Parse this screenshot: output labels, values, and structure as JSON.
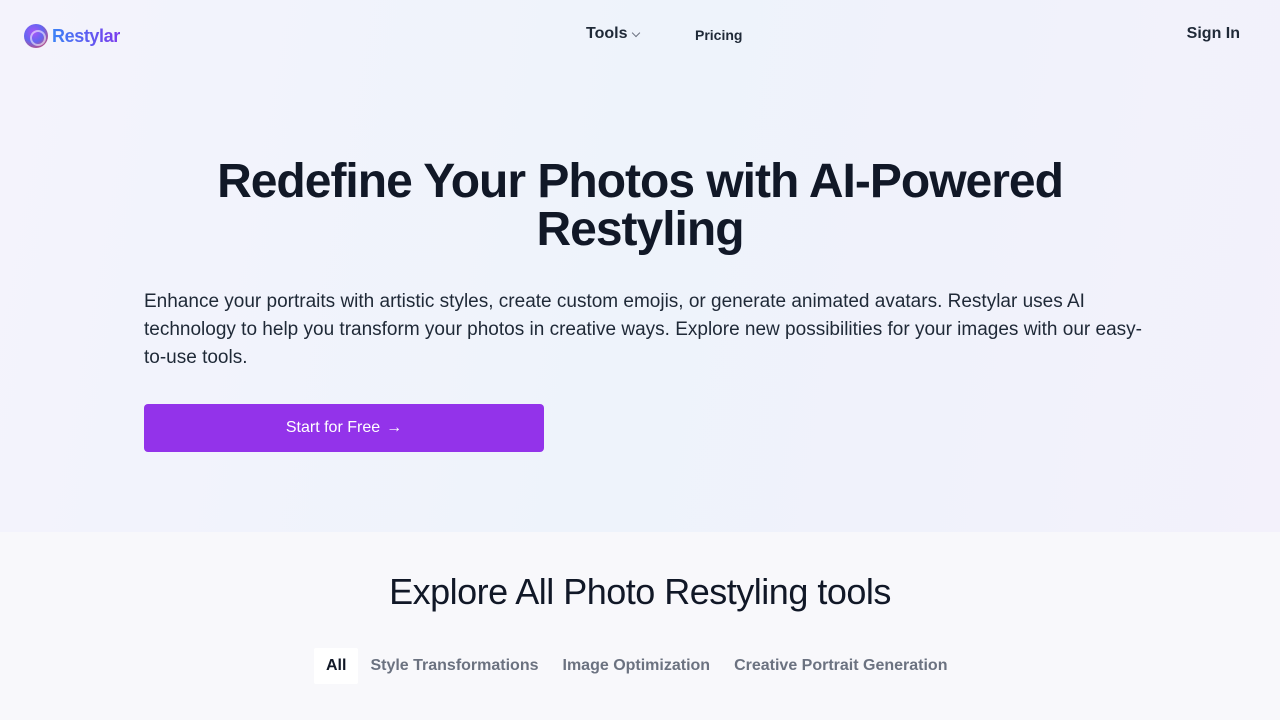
{
  "header": {
    "brand": "Restylar",
    "nav": {
      "tools_label": "Tools",
      "pricing_label": "Pricing"
    },
    "sign_in_label": "Sign In"
  },
  "hero": {
    "title": "Redefine Your Photos with AI-Powered Restyling",
    "description": "Enhance your portraits with artistic styles, create custom emojis, or generate animated avatars. Restylar uses AI technology to help you transform your photos in creative ways. Explore new possibilities for your images with our easy-to-use tools.",
    "cta_label": "Start for Free",
    "cta_arrow": "→"
  },
  "tools_section": {
    "title": "Explore All Photo Restyling tools",
    "filters": [
      {
        "label": "All",
        "active": true
      },
      {
        "label": "Style Transformations",
        "active": false
      },
      {
        "label": "Image Optimization",
        "active": false
      },
      {
        "label": "Creative Portrait Generation",
        "active": false
      }
    ]
  },
  "colors": {
    "accent": "#9333ea",
    "text_primary": "#111827",
    "text_muted": "#6b7280"
  },
  "icons": {
    "logo": "restylar-logo-icon",
    "tools_dropdown": "chevron-down-icon",
    "cta": "arrow-right-icon"
  }
}
